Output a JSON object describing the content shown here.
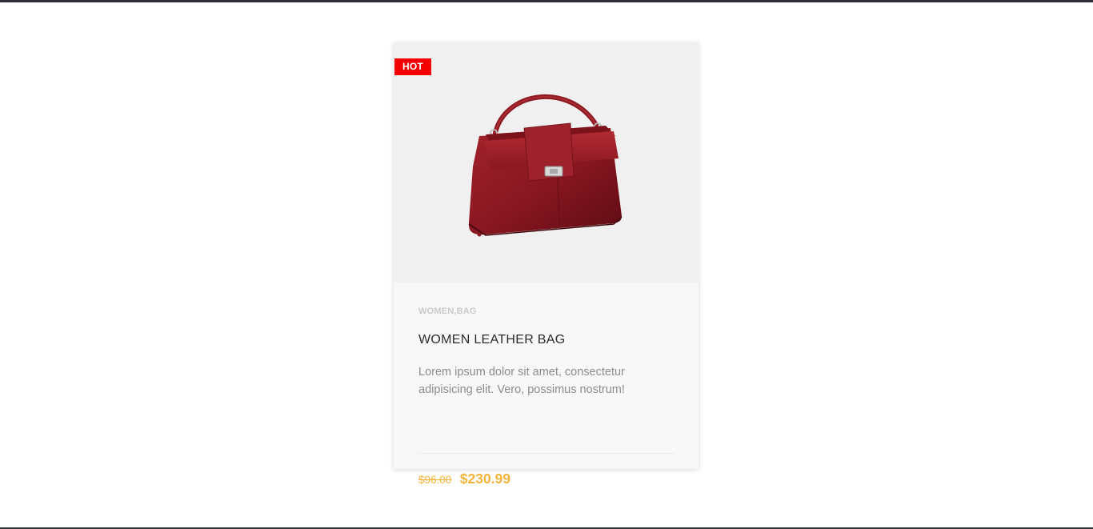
{
  "product": {
    "badge": "HOT",
    "category": "WOMEN,BAG",
    "title": "WOMEN LEATHER BAG",
    "description": "Lorem ipsum dolor sit amet, consectetur adipisicing elit. Vero, possimus nostrum!",
    "old_price": "$96.00",
    "new_price": "$230.99",
    "image_icon": "red-leather-handbag-image"
  },
  "colors": {
    "badge_bg": "#f40000",
    "price": "#f5b43c",
    "bag": "#8e1a22"
  }
}
